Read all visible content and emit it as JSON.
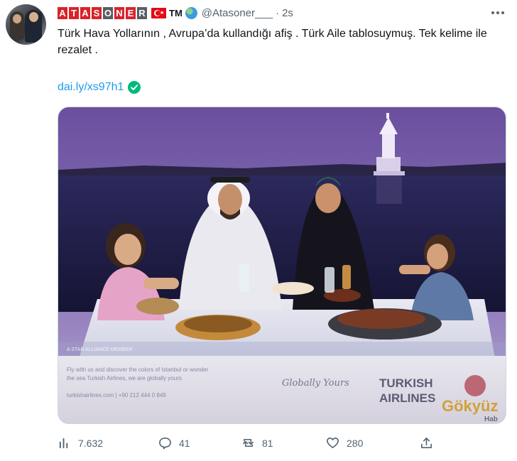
{
  "tweet": {
    "author_name_letters": [
      "A",
      "T",
      "A",
      "S",
      "O",
      "N",
      "E",
      "R"
    ],
    "author_suffix": "TM",
    "handle": "@Atasoner___",
    "separator": "·",
    "time": "2s",
    "text": "Türk Hava Yollarının , Avrupa’da kullandığı afiş . Türk Aile tablosuymuş. Tek kelime ile rezalet .",
    "link": "dai.ly/xs97h1"
  },
  "media": {
    "ad_brand_line1": "TURKISH",
    "ad_brand_line2": "AIRLINES",
    "ad_brand_overlay": "Gökyüz",
    "ad_brand_overlay2": "Hab",
    "ad_slogan": "Globally Yours",
    "ad_fine_print_1": "Fly with us and discover the colors of Istanbul or wonder",
    "ad_fine_print_2": "the sea Turkish Airlines, we are globally yours",
    "ad_fine_print_3": "turkishairlines.com | +90 212 444 0 849",
    "ad_star_alliance": "A STAR ALLIANCE MEMBER"
  },
  "actions": {
    "views": "7.632",
    "replies": "41",
    "retweets": "81",
    "likes": "280"
  },
  "colors": {
    "accent": "#1d9bf0",
    "muted": "#536471",
    "verified": "#00ba7c",
    "letter_red": "#d9232b",
    "letter_grey": "#5a5d63"
  },
  "icons": [
    "more-icon",
    "verified-icon",
    "views-icon",
    "reply-icon",
    "retweet-icon",
    "like-icon",
    "share-icon",
    "globe-icon",
    "turkey-flag-icon"
  ]
}
